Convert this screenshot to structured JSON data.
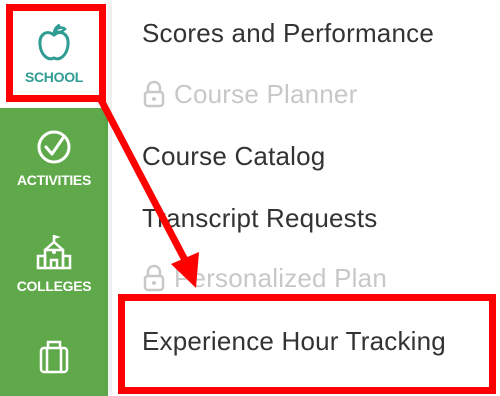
{
  "sidebar": {
    "items": [
      {
        "label": "SCHOOL",
        "icon": "apple-icon"
      },
      {
        "label": "ACTIVITIES",
        "icon": "check-circle-icon"
      },
      {
        "label": "COLLEGES",
        "icon": "college-building-icon"
      },
      {
        "label": "",
        "icon": "briefcase-icon"
      }
    ]
  },
  "menu": {
    "items": [
      {
        "label": "Scores and Performance",
        "disabled": false
      },
      {
        "label": "Course Planner",
        "disabled": true,
        "icon": "lock-icon"
      },
      {
        "label": "Course Catalog",
        "disabled": false
      },
      {
        "label": "Transcript Requests",
        "disabled": false
      },
      {
        "label": "Personalized Plan",
        "disabled": true,
        "icon": "lock-icon"
      },
      {
        "label": "Experience Hour Tracking",
        "disabled": false
      }
    ]
  },
  "colors": {
    "sidebar_green": "#5fa94a",
    "school_teal": "#2f9d93",
    "highlight_red": "#ff0000",
    "disabled_gray": "#c8c8c8"
  }
}
